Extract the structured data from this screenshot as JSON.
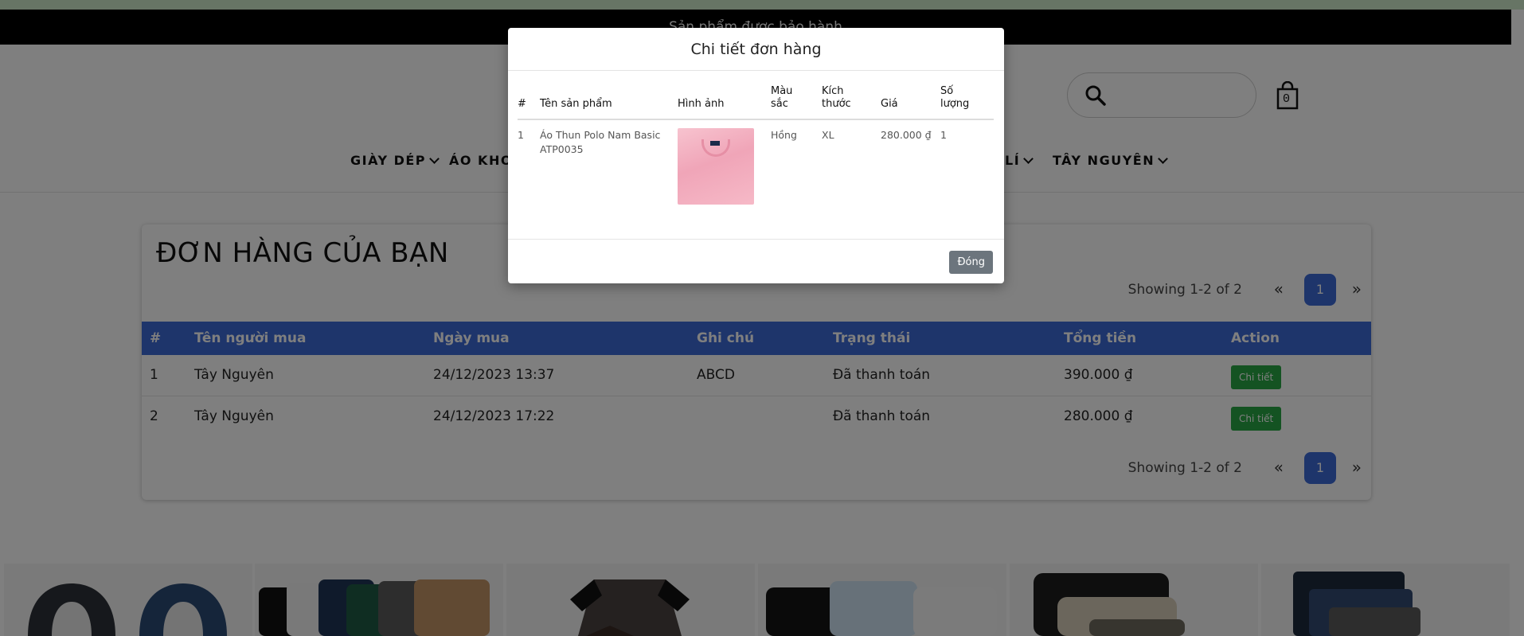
{
  "announcement": "Sản phẩm được bảo hành",
  "cart": {
    "count": "0"
  },
  "nav": {
    "items": [
      "GIÀY DÉP",
      "ÁO KHOÁC",
      "LÍ",
      "TÂY NGUYÊN"
    ]
  },
  "orders": {
    "title": "ĐƠN HÀNG CỦA BẠN",
    "pager": {
      "info": "Showing 1-2 of 2",
      "prev": "«",
      "page": "1",
      "next": "»"
    },
    "columns": [
      "#",
      "Tên người mua",
      "Ngày mua",
      "Ghi chú",
      "Trạng thái",
      "Tổng tiền",
      "Action"
    ],
    "rows": [
      {
        "num": "1",
        "buyer": "Tây Nguyên",
        "date": "24/12/2023 13:37",
        "note": "ABCD",
        "status": "Đã thanh toán",
        "total": "390.000 ₫",
        "action": "Chi tiết"
      },
      {
        "num": "2",
        "buyer": "Tây Nguyên",
        "date": "24/12/2023 17:22",
        "note": "",
        "status": "Đã thanh toán",
        "total": "280.000 ₫",
        "action": "Chi tiết"
      }
    ]
  },
  "modal": {
    "title": "Chi tiết đơn hàng",
    "columns": [
      "#",
      "Tên sản phẩm",
      "Hình ảnh",
      "Màu sắc",
      "Kích thước",
      "Giá",
      "Số lượng"
    ],
    "rows": [
      {
        "num": "1",
        "product": "Áo Thun Polo Nam Basic ATP0035",
        "color": "Hồng",
        "size": "XL",
        "price": "280.000 ₫",
        "qty": "1"
      }
    ],
    "close_label": "Đóng"
  },
  "colors": {
    "primary": "#3d6ad6",
    "success": "#28a745",
    "secondary": "#6c757d",
    "topstrip": "#cfeacb"
  }
}
